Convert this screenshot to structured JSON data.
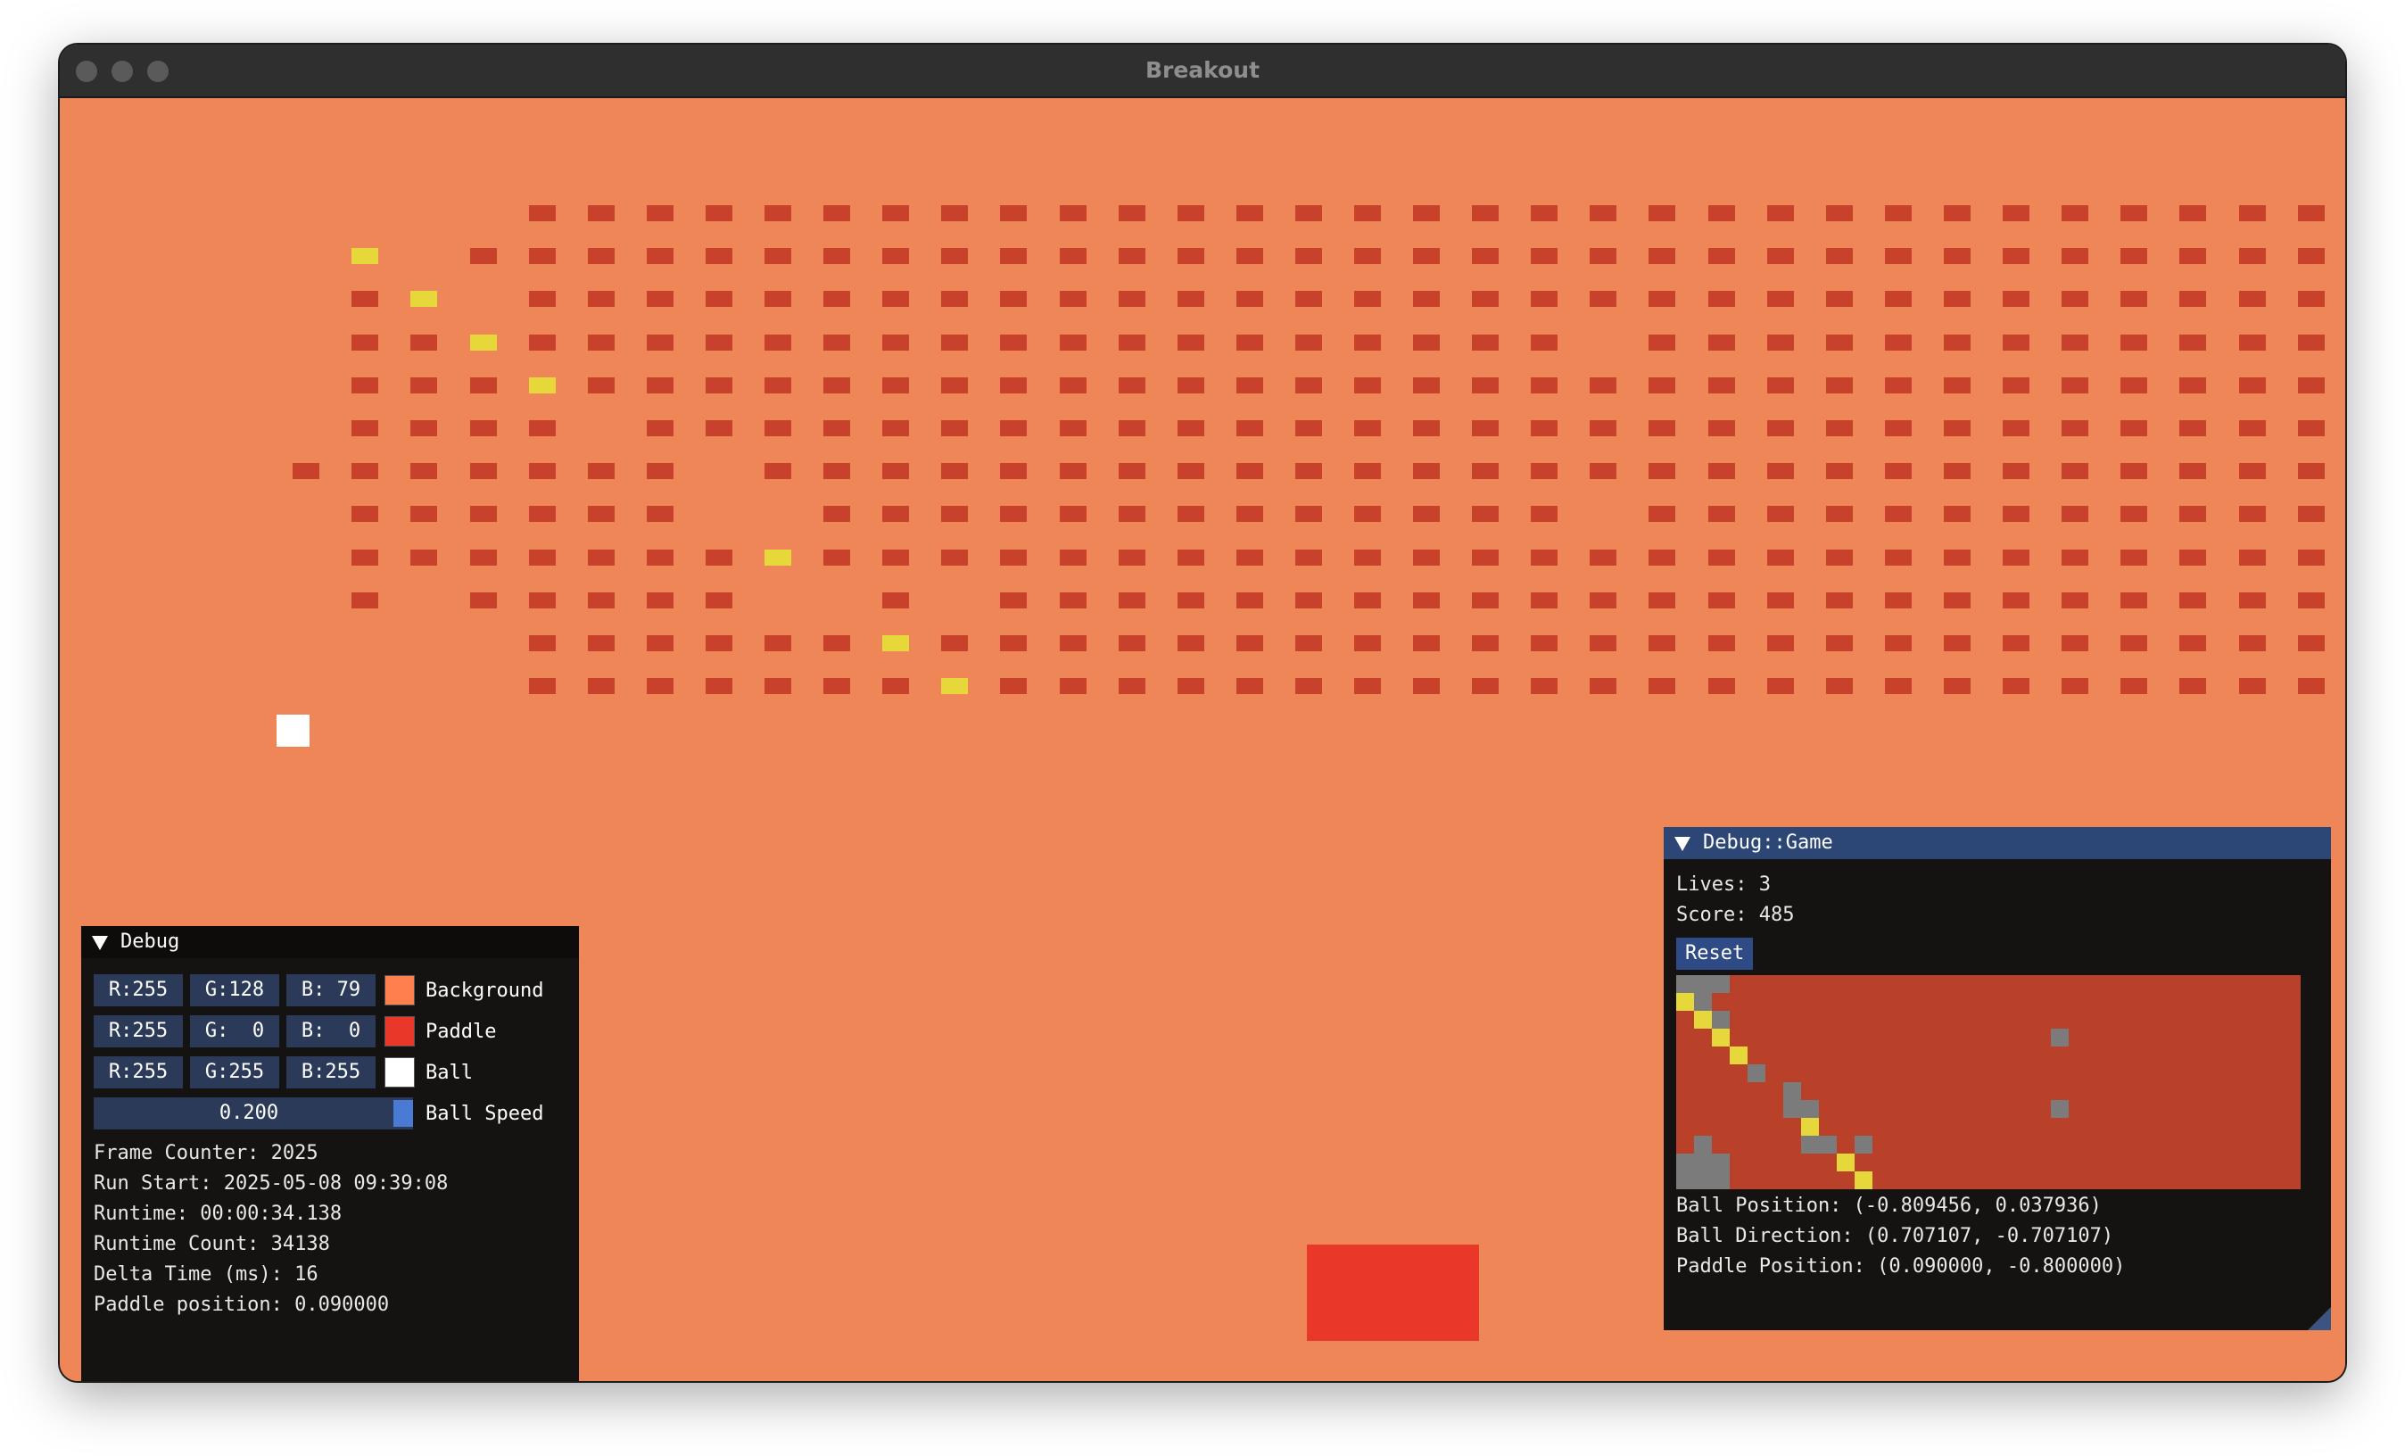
{
  "window": {
    "title": "Breakout"
  },
  "colors": {
    "background": "#ef8657",
    "brick": "#c8412b",
    "brick_highlight": "#e6d83a",
    "paddle": "#e9372a",
    "ball": "#ffffff",
    "panel_bg": "#151311",
    "panel_header": "#2c4676",
    "field_bg": "#2b3a58",
    "slider_grab": "#4a7ad4"
  },
  "game": {
    "brick_columns": [
      [
        "1R",
        "1R",
        "1R",
        "1R",
        "1R",
        "1R",
        "1R",
        "1R",
        "1R",
        "1R",
        "1R",
        "1R"
      ],
      [
        "1R",
        "1R",
        "1R",
        "1R",
        "1R",
        "1R",
        "1R",
        "1R",
        "1R",
        "1R",
        "1R",
        "1R"
      ],
      [
        "1R",
        "1R",
        "1R",
        "1R",
        "1R",
        "1R",
        "1R",
        "1R",
        "1R",
        "1R",
        "1R",
        "1R"
      ],
      [
        "1R",
        "1R",
        "1R",
        "1R",
        "1R",
        "1R",
        "1R",
        "1R",
        "1R",
        "1R",
        "1R",
        "1R"
      ],
      [
        "1R",
        "1R",
        "1R",
        "1R",
        "1R",
        "1R",
        "1R",
        "1R",
        "1R",
        "1R",
        "1R",
        "1R"
      ]
    ],
    "brick_rows": [
      "      RRRRRRRRRRRRRRRRRRRRRRRRRRRRRRRRRRR",
      "   Y RRRRRRRRRRRRRRRRRRRRRRRRRRRRRRRRRRR",
      "   RY RRRRRRRRRRRRRRRRRRRRRRRRRRRRRRRRRR",
      "   RRYRRRRRRRRRRRRRRRRRR RRRRRRRRRRRRRR",
      "   RRRYRRRRRRRRRRRRRRRRRRRRRRRRRRRRRR",
      "   RRRR RRRRRRRRRRRRRRRRRRRRRRRRRRRRRR",
      "  RRRRRRR RRRRRRRRRRRRRRRRRRRRRRRRRRRRRRR",
      "   RRRRRR  RRRRRRRRRRRRR RRRRRRRRRRRRRR",
      "   RRRRRRRYRRRRRRRRRRRRRRRRRRRRRRRRRRRR",
      "   R RRRRR  R RRRRRRRRRRRRRRRRRRRRRRRRR",
      "      RRRRRRYRRRRRRRRRRRRRRRRRRRRRRRRR",
      "      RRRRRRRYRRRRRRRRRRRRRRRRRRRRRRRR"
    ],
    "paddle_position": 0.09,
    "ball_position": [
      -0.809456,
      0.037936
    ]
  },
  "debug": {
    "title": "Debug",
    "rows": [
      {
        "r": "R:255",
        "g": "G:128",
        "b": "B: 79",
        "swatch": "#ff804f",
        "label": "Background"
      },
      {
        "r": "R:255",
        "g": "G:  0",
        "b": "B:  0",
        "swatch": "#ff0000",
        "label": "Paddle"
      },
      {
        "r": "R:255",
        "g": "G:255",
        "b": "B:255",
        "swatch": "#ffffff",
        "label": "Ball"
      }
    ],
    "ball_speed": {
      "value": "0.200",
      "label": "Ball Speed",
      "fraction": 0.2
    },
    "lines": [
      "Frame Counter: 2025",
      "Run Start: 2025-05-08 09:39:08",
      "Runtime: 00:00:34.138",
      "Runtime Count: 34138",
      "Delta Time (ms): 16",
      "Paddle position: 0.090000"
    ]
  },
  "debug_game": {
    "title": "Debug::Game",
    "lives": "Lives: 3",
    "score": "Score: 485",
    "reset_label": "Reset",
    "lines": [
      "Ball Position: (-0.809456, 0.037936)",
      "Ball Direction: (0.707107, -0.707107)",
      "Paddle Position: (0.090000, -0.800000)"
    ]
  }
}
